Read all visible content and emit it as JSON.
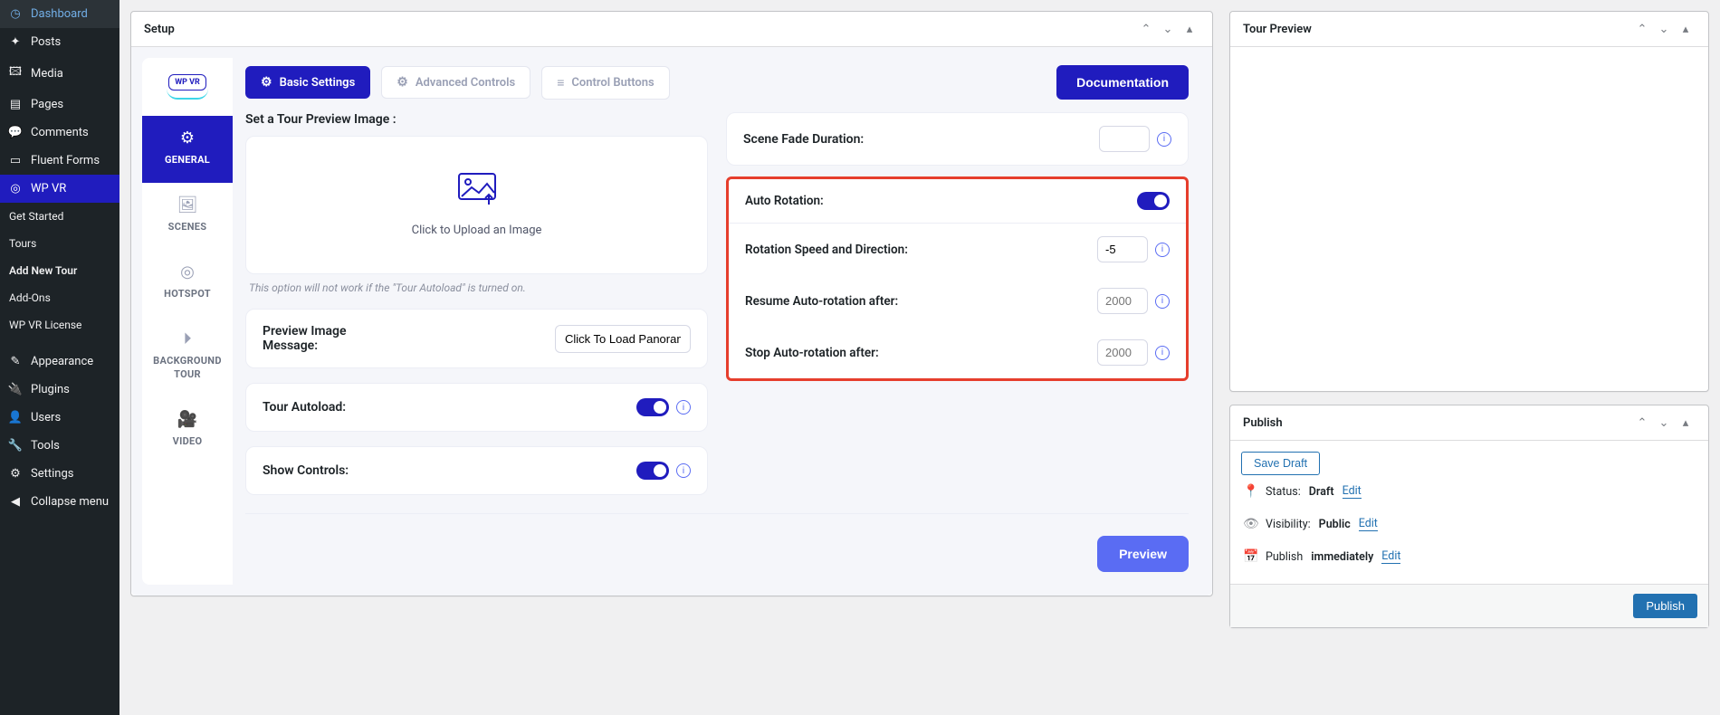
{
  "sidebar": {
    "items": [
      {
        "label": "Dashboard",
        "icon": "◷"
      },
      {
        "label": "Posts",
        "icon": "✦"
      },
      {
        "label": "Media",
        "icon": "🖾"
      },
      {
        "label": "Pages",
        "icon": "▤"
      },
      {
        "label": "Comments",
        "icon": "💬"
      },
      {
        "label": "Fluent Forms",
        "icon": "▭"
      },
      {
        "label": "WP VR",
        "icon": "◎"
      }
    ],
    "sub": [
      {
        "label": "Get Started"
      },
      {
        "label": "Tours"
      },
      {
        "label": "Add New Tour"
      },
      {
        "label": "Add-Ons"
      },
      {
        "label": "WP VR License"
      }
    ],
    "items2": [
      {
        "label": "Appearance",
        "icon": "✎"
      },
      {
        "label": "Plugins",
        "icon": "🔌"
      },
      {
        "label": "Users",
        "icon": "👤"
      },
      {
        "label": "Tools",
        "icon": "🔧"
      },
      {
        "label": "Settings",
        "icon": "⚙"
      },
      {
        "label": "Collapse menu",
        "icon": "◀"
      }
    ]
  },
  "setup": {
    "title": "Setup",
    "logo_text": "WP VR",
    "tabs": {
      "general": {
        "label": "GENERAL"
      },
      "scenes": {
        "label": "SCENES"
      },
      "hotspot": {
        "label": "HOTSPOT"
      },
      "background": {
        "label": "BACKGROUND TOUR"
      },
      "video": {
        "label": "VIDEO"
      }
    },
    "top": {
      "basic": "Basic Settings",
      "advanced": "Advanced Controls",
      "control": "Control Buttons",
      "documentation": "Documentation"
    },
    "left": {
      "preview_title": "Set a Tour Preview Image :",
      "upload_label": "Click to Upload an Image",
      "note": "This option will not work if the \"Tour Autoload\" is turned on.",
      "preview_msg_label": "Preview Image Message:",
      "preview_msg_value": "Click To Load Panoram",
      "autoload_label": "Tour Autoload:",
      "show_controls_label": "Show Controls:"
    },
    "right": {
      "fade_label": "Scene Fade Duration:",
      "fade_value": "",
      "auto_rotation_label": "Auto Rotation:",
      "speed_label": "Rotation Speed and Direction:",
      "speed_value": "-5",
      "resume_label": "Resume Auto-rotation after:",
      "resume_placeholder": "2000",
      "stop_label": "Stop Auto-rotation after:",
      "stop_placeholder": "2000"
    },
    "preview_btn": "Preview"
  },
  "tour_preview": {
    "title": "Tour Preview"
  },
  "publish": {
    "title": "Publish",
    "save_draft": "Save Draft",
    "status_label": "Status:",
    "status_value": "Draft",
    "visibility_label": "Visibility:",
    "visibility_value": "Public",
    "publish_label": "Publish",
    "publish_value": "immediately",
    "edit": "Edit",
    "button": "Publish"
  }
}
